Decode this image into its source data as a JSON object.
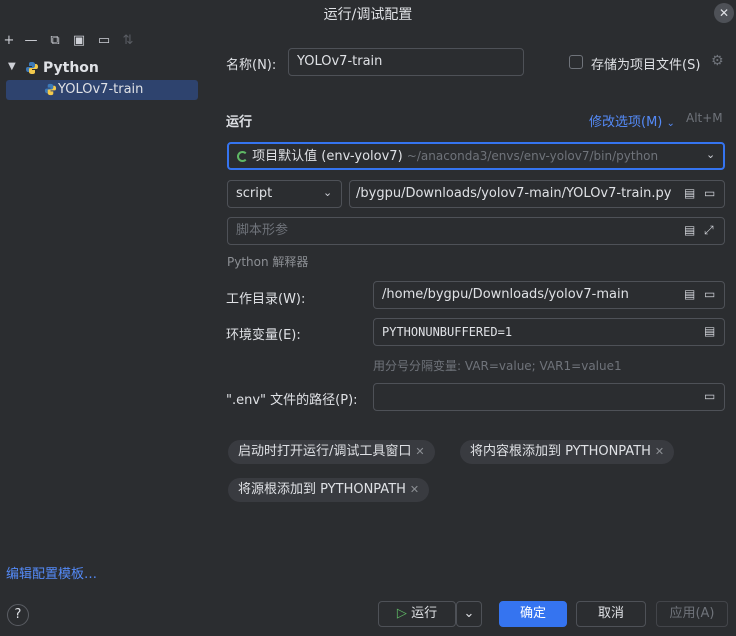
{
  "window": {
    "title": "运行/调试配置"
  },
  "colors": {
    "accent": "#3574f0",
    "link": "#548af7",
    "background": "#2b2d30",
    "python_icon_blue": "#3d7ab8",
    "python_icon_yellow": "#f2c94c",
    "spinner": "#5fb865"
  },
  "icons": {
    "close": "close-icon",
    "toolbar": [
      "add-icon",
      "remove-icon",
      "copy-icon",
      "save-icon",
      "folder-icon",
      "sort-icon"
    ],
    "tree_arrow": "chevron-down-icon",
    "python": "python-icon",
    "gear": "gear-icon",
    "help": "help-icon",
    "play": "play-icon"
  },
  "tree": {
    "group_label": "Python",
    "item_label": "YOLOv7-train"
  },
  "bottom_left": {
    "edit_templates": "编辑配置模板…",
    "help": "?"
  },
  "form": {
    "name_label": "名称(N):",
    "name_value": "YOLOv7-train",
    "store_as_file_label": "存储为项目文件(S)",
    "store_as_file_checked": false,
    "run_section": "运行",
    "modify_options": "修改选项(M)",
    "modify_shortcut": "Alt+M",
    "interpreter_value": "项目默认值 (env-yolov7)",
    "interpreter_path": "~/anaconda3/envs/env-yolov7/bin/python",
    "target_type": "script",
    "script_path": "/bygpu/Downloads/yolov7-main/YOLOv7-train.py",
    "script_params_placeholder": "脚本形参",
    "interpreter_options_label": "Python 解释器",
    "workdir_label": "工作目录(W):",
    "workdir_value": "/home/bygpu/Downloads/yolov7-main",
    "env_label": "环境变量(E):",
    "env_value": "PYTHONUNBUFFERED=1",
    "env_hint": "用分号分隔变量: VAR=value; VAR1=value1",
    "dotenv_label": "\".env\" 文件的路径(P):",
    "dotenv_value": ""
  },
  "chips": [
    "启动时打开运行/调试工具窗口",
    "将内容根添加到 PYTHONPATH",
    "将源根添加到 PYTHONPATH"
  ],
  "buttons": {
    "run": "运行",
    "ok": "确定",
    "cancel": "取消",
    "apply": "应用(A)"
  }
}
